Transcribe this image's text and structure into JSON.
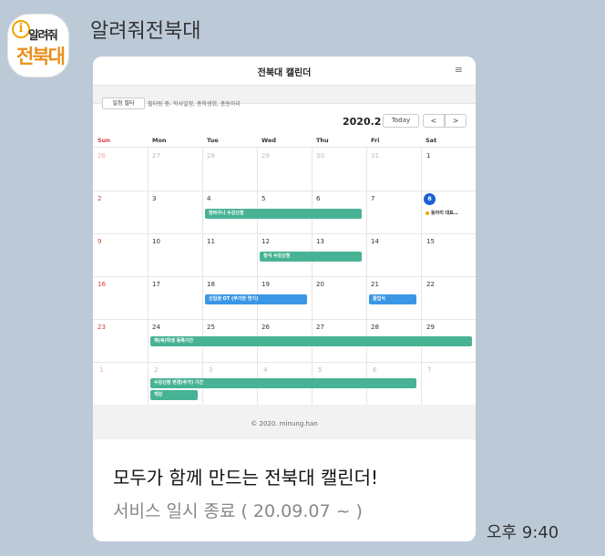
{
  "chat": {
    "sender_name": "알려줘전북대",
    "avatar_line1": "알려줘",
    "avatar_line2": "전북대",
    "time": "오후 9:40"
  },
  "card": {
    "title": "모두가 함께 만드는 전북대 캘린더!",
    "subtitle": "서비스 일시 종료 ( 20.09.07 ~ )"
  },
  "calendar": {
    "app_title": "전북대 캘린더",
    "menu_icon": "hamburger-icon",
    "filter_button": "일정 필터",
    "filter_text": "필터링 중- 학사일정, 총학생회, 총동아리",
    "month_label": "2020.2",
    "today_button": "Today",
    "prev_label": "<",
    "next_label": ">",
    "weekdays": [
      "Sun",
      "Mon",
      "Tue",
      "Wed",
      "Thu",
      "Fri",
      "Sat"
    ],
    "weeks": [
      [
        "26",
        "27",
        "28",
        "29",
        "30",
        "31",
        "1"
      ],
      [
        "2",
        "3",
        "4",
        "5",
        "6",
        "7",
        "8"
      ],
      [
        "9",
        "10",
        "11",
        "12",
        "13",
        "14",
        "15"
      ],
      [
        "16",
        "17",
        "18",
        "19",
        "20",
        "21",
        "22"
      ],
      [
        "23",
        "24",
        "25",
        "26",
        "27",
        "28",
        "29"
      ],
      [
        "1",
        "2",
        "3",
        "4",
        "5",
        "6",
        "7"
      ]
    ],
    "events": [
      {
        "label": "장바구니 수강신청",
        "color": "#48b394"
      },
      {
        "label": "동아리 대표…",
        "color": "#f0a500"
      },
      {
        "label": "정식 수강신청",
        "color": "#48b394"
      },
      {
        "label": "신입생 OT (무기한 연기)",
        "color": "#3b97e6"
      },
      {
        "label": "졸업식",
        "color": "#3b97e6"
      },
      {
        "label": "재(복)학생 등록기간",
        "color": "#48b394"
      },
      {
        "label": "수강신청 변경(추가) 기간",
        "color": "#48b394"
      },
      {
        "label": "개강",
        "color": "#48b394"
      }
    ],
    "footer": "© 2020. minung.han"
  }
}
